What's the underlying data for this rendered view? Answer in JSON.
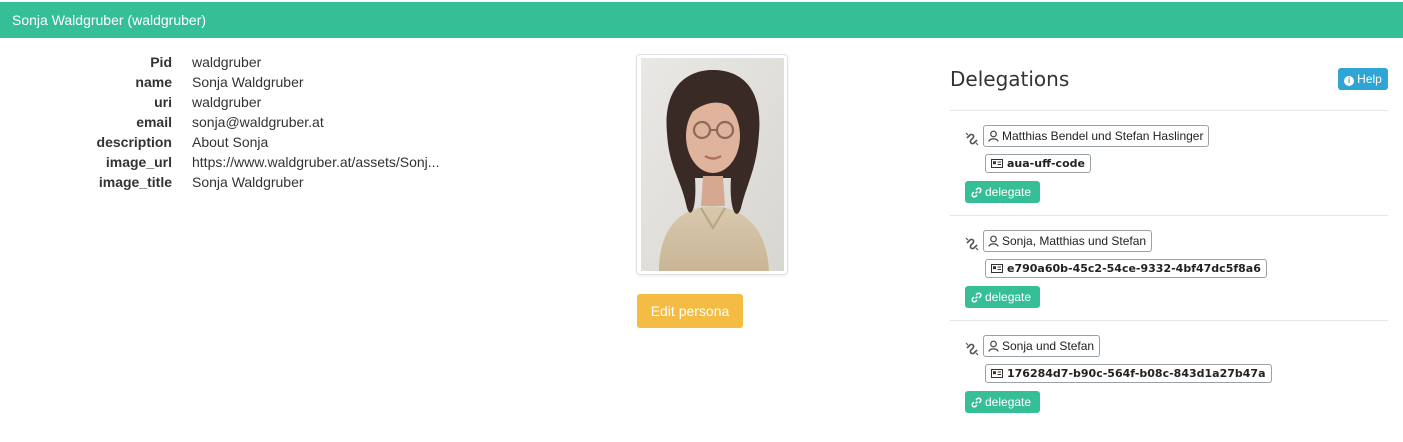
{
  "header": {
    "title": "Sonja Waldgruber (waldgruber)"
  },
  "properties": [
    {
      "key": "Pid",
      "value": "waldgruber"
    },
    {
      "key": "name",
      "value": "Sonja Waldgruber"
    },
    {
      "key": "uri",
      "value": "waldgruber"
    },
    {
      "key": "email",
      "value": "sonja@waldgruber.at"
    },
    {
      "key": "description",
      "value": "About Sonja"
    },
    {
      "key": "image_url",
      "value": "https://www.waldgruber.at/assets/Sonj..."
    },
    {
      "key": "image_title",
      "value": "Sonja Waldgruber"
    }
  ],
  "actions": {
    "edit_label": "Edit persona"
  },
  "delegations": {
    "title": "Delegations",
    "help_label": "Help",
    "items": [
      {
        "person": "Matthias Bendel und Stefan Haslinger",
        "code": "aua-uff-code",
        "button": "delegate"
      },
      {
        "person": "Sonja, Matthias und Stefan",
        "code": "e790a60b-45c2-54ce-9332-4bf47dc5f8a6",
        "button": "delegate"
      },
      {
        "person": "Sonja und Stefan",
        "code": "176284d7-b90c-564f-b08c-843d1a27b47a",
        "button": "delegate"
      }
    ]
  },
  "colors": {
    "header": "#36bf96",
    "edit_button": "#f4bc42",
    "help_button": "#2fa5d6",
    "delegate_button": "#36bf96"
  },
  "icons": [
    "info-circle-icon",
    "unlink-icon",
    "user-icon",
    "id-card-icon",
    "link-icon"
  ]
}
